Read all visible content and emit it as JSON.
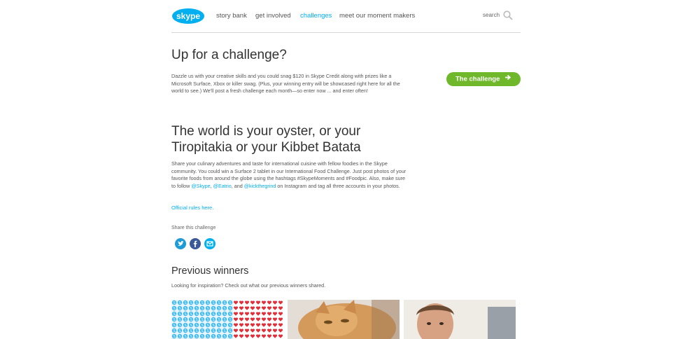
{
  "header": {
    "logo_text": "skype",
    "nav": [
      "story bank",
      "get involved",
      "challenges",
      "meet our moment makers"
    ],
    "active_nav": "challenges",
    "search_label": "search"
  },
  "intro": {
    "title": "Up for a challenge?",
    "body": "Dazzle us with your creative skills and you could snag $120 in Skype Credit along with prizes like a Microsoft Surface, Xbox or killer swag. (Plus, your winning entry will be showcased right here for all the world to see.) We'll post a fresh challenge each month—so enter now ... and enter often!",
    "cta_label": "The challenge"
  },
  "challenge": {
    "title": "The world is your oyster, or your Tiropitakia or your Kibbet Batata",
    "body_a": "Share your culinary adventures and taste for international cuisine with fellow foodies in the Skype community. You could win a Surface 2 tablet in our International Food Challenge. Just post photos of your favorite foods from around the globe using the hashtags #SkypeMoments and #Foodpic. Also, make sure to follow ",
    "handle_skype": "@Skype",
    "sep1": ", ",
    "handle_eatrio": "@Eatrio",
    "sep2": ", and ",
    "handle_kick": "@kickthegrind",
    "body_b": " on Instagram and tag all three accounts in your photos.",
    "official_rules": "Official rules here.",
    "share_label": "Share this challenge",
    "share_icons": [
      "twitter-icon",
      "facebook-icon",
      "email-icon"
    ]
  },
  "winners": {
    "title": "Previous winners",
    "body": "Looking for inspiration? Check out what our previous winners shared."
  },
  "colors": {
    "accent": "#00aff0",
    "cta": "#6fb72b"
  }
}
